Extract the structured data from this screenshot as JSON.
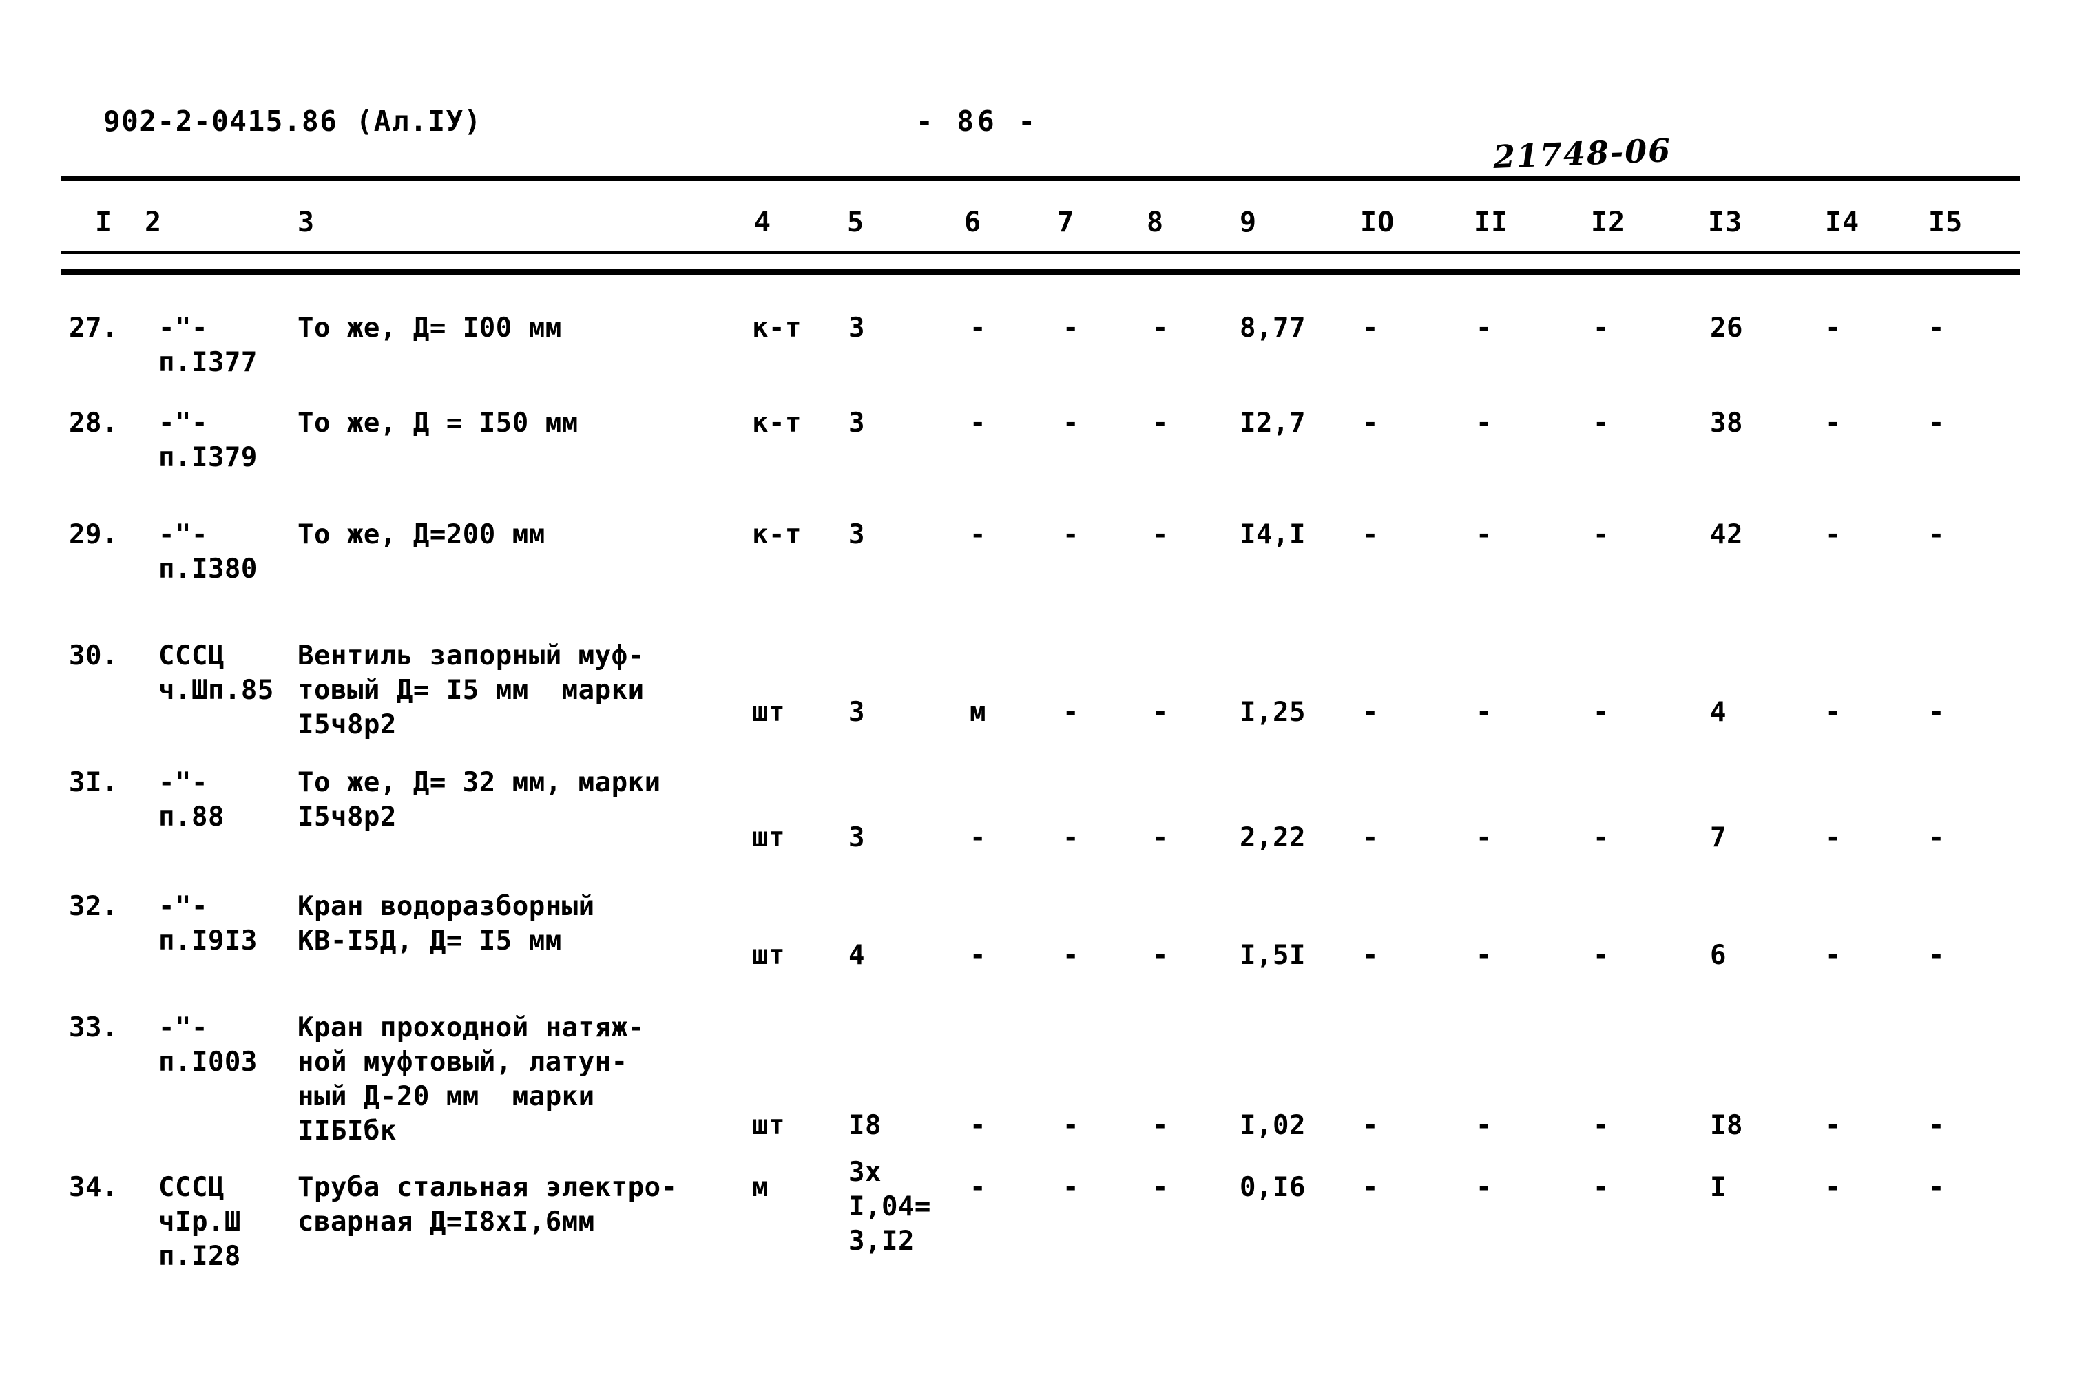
{
  "header": {
    "doc_code": "902-2-0415.86 (Ал.IУ)",
    "page_number": "- 86 -",
    "stamp": "21748-06"
  },
  "table": {
    "column_headers": [
      "I",
      "2",
      "3",
      "4",
      "5",
      "6",
      "7",
      "8",
      "9",
      "IO",
      "II",
      "I2",
      "I3",
      "I4",
      "I5"
    ],
    "rows": [
      {
        "no": "27.",
        "code_line1": "-\"-",
        "code_line2": "п.I377",
        "desc": [
          "То же, Д= I00 мм"
        ],
        "unit": "к-т",
        "c5": "3",
        "c6": "-",
        "c7": "-",
        "c8": "-",
        "c9": "8,77",
        "c10": "-",
        "c11": "-",
        "c12": "-",
        "c13": "26",
        "c14": "-",
        "c15": "-"
      },
      {
        "no": "28.",
        "code_line1": "-\"-",
        "code_line2": "п.I379",
        "desc": [
          "То же, Д = I50 мм"
        ],
        "unit": "к-т",
        "c5": "3",
        "c6": "-",
        "c7": "-",
        "c8": "-",
        "c9": "I2,7",
        "c10": "-",
        "c11": "-",
        "c12": "-",
        "c13": "38",
        "c14": "-",
        "c15": "-"
      },
      {
        "no": "29.",
        "code_line1": "-\"-",
        "code_line2": "п.I380",
        "desc": [
          "То же, Д=200 мм"
        ],
        "unit": "к-т",
        "c5": "3",
        "c6": "-",
        "c7": "-",
        "c8": "-",
        "c9": "I4,I",
        "c10": "-",
        "c11": "-",
        "c12": "-",
        "c13": "42",
        "c14": "-",
        "c15": "-"
      },
      {
        "no": "30.",
        "code_line1": "СССЦ",
        "code_line2": "ч.Шп.85",
        "desc": [
          "Вентиль запорный муф-",
          "товый Д= I5 мм  марки",
          "I5ч8р2"
        ],
        "unit": "шт",
        "c5": "3",
        "c6": "м",
        "c7": "-",
        "c8": "-",
        "c9": "I,25",
        "c10": "-",
        "c11": "-",
        "c12": "-",
        "c13": "4",
        "c14": "-",
        "c15": "-"
      },
      {
        "no": "3I.",
        "code_line1": "-\"-",
        "code_line2": "п.88",
        "desc": [
          "То же, Д= 32 мм, марки",
          "I5ч8р2"
        ],
        "unit": "шт",
        "c5": "3",
        "c6": "-",
        "c7": "-",
        "c8": "-",
        "c9": "2,22",
        "c10": "-",
        "c11": "-",
        "c12": "-",
        "c13": "7",
        "c14": "-",
        "c15": "-"
      },
      {
        "no": "32.",
        "code_line1": "-\"-",
        "code_line2": "п.I9I3",
        "desc": [
          "Кран водоразборный",
          "КВ-I5Д, Д= I5 мм"
        ],
        "unit": "шт",
        "c5": "4",
        "c6": "-",
        "c7": "-",
        "c8": "-",
        "c9": "I,5I",
        "c10": "-",
        "c11": "-",
        "c12": "-",
        "c13": "6",
        "c14": "-",
        "c15": "-"
      },
      {
        "no": "33.",
        "code_line1": "-\"-",
        "code_line2": "п.I003",
        "desc": [
          "Кран проходной натяж-",
          "ной муфтовый, латун-",
          "ный Д-20 мм  марки",
          "IIБIбк"
        ],
        "unit": "шт",
        "c5": "I8",
        "c6": "-",
        "c7": "-",
        "c8": "-",
        "c9": "I,02",
        "c10": "-",
        "c11": "-",
        "c12": "-",
        "c13": "I8",
        "c14": "-",
        "c15": "-"
      },
      {
        "no": "34.",
        "code_line1": "СССЦ",
        "code_line2": "чIр.Ш",
        "code_line3": "п.I28",
        "desc": [
          "Труба стальная электро-",
          "сварная Д=I8хI,6мм"
        ],
        "unit": "м",
        "c5": "3х\nI,04=\n3,I2",
        "c6": "-",
        "c7": "-",
        "c8": "-",
        "c9": "0,I6",
        "c10": "-",
        "c11": "-",
        "c12": "-",
        "c13": "I",
        "c14": "-",
        "c15": "-"
      }
    ]
  }
}
